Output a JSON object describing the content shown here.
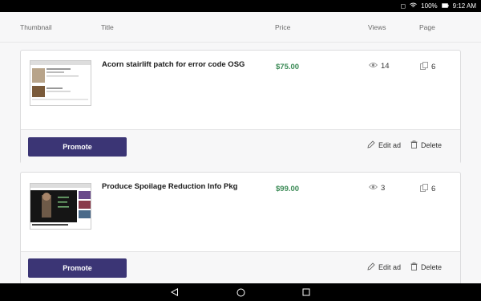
{
  "status_bar": {
    "battery": "100%",
    "time": "9:12 AM"
  },
  "table_header": {
    "thumbnail": "Thumbnail",
    "title": "Title",
    "price": "Price",
    "views": "Views",
    "page": "Page"
  },
  "ads": [
    {
      "title": "Acorn stairlift patch for error code OSG",
      "price": "$75.00",
      "views": "14",
      "page": "6",
      "promote_label": "Promote",
      "edit_label": "Edit ad",
      "delete_label": "Delete"
    },
    {
      "title": "Produce Spoilage Reduction Info Pkg",
      "price": "$99.00",
      "views": "3",
      "page": "6",
      "promote_label": "Promote",
      "edit_label": "Edit ad",
      "delete_label": "Delete"
    }
  ],
  "icons": {
    "views": "eye-icon",
    "page": "pages-icon",
    "edit": "pencil-icon",
    "delete": "trash-icon",
    "back": "back-icon",
    "home": "home-icon",
    "recents": "recents-icon"
  },
  "colors": {
    "promote_button": "#3b3575",
    "price": "#3a8a55",
    "card_footer": "#f7f7f8"
  }
}
